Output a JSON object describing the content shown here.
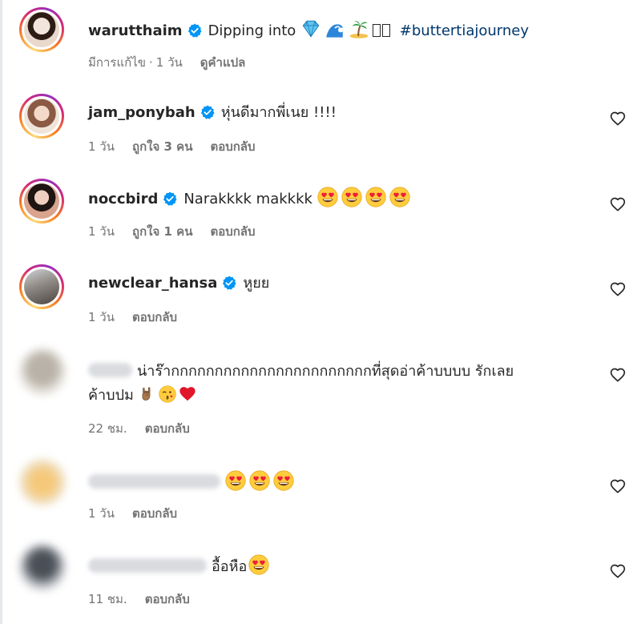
{
  "caption": {
    "username": "warutthaim",
    "text_prefix": "Dipping into",
    "emoji_icons": [
      "gem-icon",
      "wave-icon",
      "island-icon"
    ],
    "hashtag": "#buttertiajourney",
    "edited_label": "มีการแก้ไข",
    "time": "1 วัน",
    "translate_label": "ดูคำแปล"
  },
  "comments": [
    {
      "username": "jam_ponybah",
      "verified": true,
      "text": "หุ่นดีมากพี่เนย !!!!",
      "time": "1 วัน",
      "likes": "ถูกใจ 3 คน",
      "reply": "ตอบกลับ"
    },
    {
      "username": "noccbird",
      "verified": true,
      "text": "Narakkkk makkkk",
      "emojis": [
        "heart-eyes-icon",
        "heart-eyes-icon",
        "heart-eyes-icon",
        "heart-eyes-icon"
      ],
      "time": "1 วัน",
      "likes": "ถูกใจ 1 คน",
      "reply": "ตอบกลับ"
    },
    {
      "username": "newclear_hansa",
      "verified": true,
      "text": "หูยย",
      "time": "1 วัน",
      "reply": "ตอบกลับ"
    },
    {
      "username_blurred": true,
      "text_line1": "น่าร๊ากกกกกกกกกกกกกกกกกกกกกกกที่สุดอ่าค้าบบบบ รักเลย",
      "text_line2": "ค้าบปม",
      "emojis": [
        "rock-hand-icon",
        "kiss-face-icon",
        "red-heart-icon"
      ],
      "time": "22 ชม.",
      "reply": "ตอบกลับ"
    },
    {
      "username_blurred": true,
      "emojis": [
        "heart-eyes-icon",
        "heart-eyes-icon",
        "heart-eyes-icon"
      ],
      "time": "1 วัน",
      "reply": "ตอบกลับ"
    },
    {
      "username_blurred": true,
      "text": "อื้อหือ",
      "emojis": [
        "heart-eyes-icon"
      ],
      "time": "11 ชม.",
      "reply": "ตอบกลับ"
    }
  ],
  "colors": {
    "text": "#262626",
    "meta": "#737373",
    "verified": "#0095f6",
    "hashtag": "#00376b"
  }
}
